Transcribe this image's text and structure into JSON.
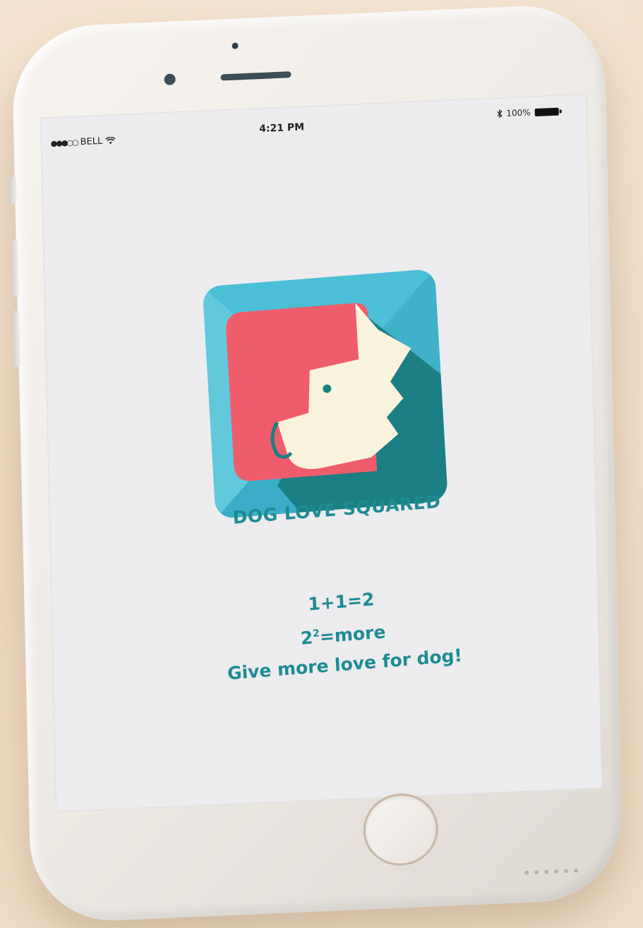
{
  "status_bar": {
    "carrier": "BELL",
    "time": "4:21 PM",
    "battery": "100%"
  },
  "app": {
    "name": "DOG LOVE SQUARED",
    "tagline_line1": "1+1=2",
    "tagline_line2_base": "2",
    "tagline_line2_sup": "2",
    "tagline_line2_rest": "=more",
    "tagline_line3": "Give more love for dog!"
  },
  "colors": {
    "brand_teal": "#1e8b94",
    "icon_bg": "#4bbfd6",
    "icon_coral": "#ef5d6d",
    "icon_dark_teal": "#1b7f84",
    "icon_cream": "#faf3dc"
  },
  "icons": {
    "wifi": "wifi-icon",
    "bluetooth": "bluetooth-icon",
    "battery": "battery-icon",
    "app_logo": "dog-face-icon"
  }
}
